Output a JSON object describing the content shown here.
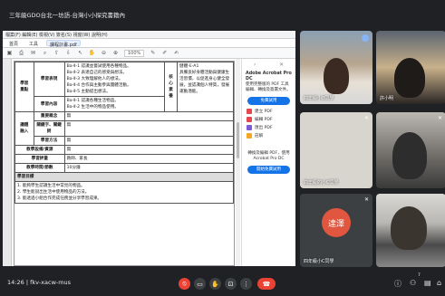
{
  "meeting": {
    "title": "三年級GDO台北一坊語-台灣小小探究書籍內",
    "time": "14:26",
    "code": "fkv-xacw-mus",
    "participants_badge": "7"
  },
  "document": {
    "menubar": "檔案(F)  編輯(E)  檢視(V)  簽名(S)  視窗(W)  說明(H)",
    "tabs": [
      "首頁",
      "工具",
      "課程計畫.pdf"
    ],
    "zoom": "100%",
    "rows": [
      {
        "label": "學習表現",
        "text": "Ba-Ⅱ-1 認識並嘗試使用各種物品。\nBa-Ⅱ-2 表達自己的感受與想法。\nBa-Ⅱ-3 大致理解他人的想法。\nBa-Ⅱ-4 合作與主動參與團體活動。\nBa-Ⅱ-5 主動提出想法。",
        "right_label": "核心素養",
        "right_text": "健體-E-A1\n具備良好身體活動與健康生活習慣，以促進身心健全發展，並認識個人特質，發展運動潛能。"
      },
      {
        "label": "學習內容",
        "text": "Ba-Ⅱ-1 認識各種生活物品。\nBa-Ⅱ-2 生活中的物品使用。"
      },
      {
        "label": "重要概念",
        "text": "無"
      },
      {
        "label": "關鍵字、關鍵詞",
        "text": "無"
      },
      {
        "label": "學習方法",
        "text": "無"
      },
      {
        "label": "教學設備/資源",
        "text": "無"
      },
      {
        "label": "學習評量",
        "text": "教師、家長"
      },
      {
        "label": "教學時間/節數",
        "text": "10分鐘"
      }
    ],
    "goals_header": "學習目標",
    "goals": [
      "1. 能夠學生認識生活中常見的物品。",
      "2. 學生能說出生活中使用物品的方法。",
      "3. 能透過小組合作完成任務並分享學習成果。"
    ]
  },
  "acrobat_panel": {
    "promo_head": "Adobe Acrobat Pro DC",
    "promo_body": "使用完整版的 PDF 工具編輯、轉換及簽署文件。",
    "try_button": "免費試用",
    "items": [
      {
        "label": "建立 PDF",
        "color": "#e34850",
        "icon": "create-pdf-icon"
      },
      {
        "label": "編輯 PDF",
        "color": "#e34850",
        "icon": "edit-pdf-icon"
      },
      {
        "label": "匯出 PDF",
        "color": "#7b5bdc",
        "icon": "export-pdf-icon"
      },
      {
        "label": "註解",
        "color": "#f5a623",
        "icon": "comment-icon"
      }
    ],
    "promo2": "轉換及編輯 PDF，使用 Acrobat Pro DC",
    "free_button": "開始免費試用"
  },
  "participants": [
    {
      "name": "四年級小B同學",
      "tile": "t1"
    },
    {
      "name": "許小明",
      "tile": "t2"
    },
    {
      "name": "四年級的小C同學",
      "tile": "t3"
    },
    {
      "name": "",
      "tile": "t4"
    },
    {
      "name": "四年級小C同學",
      "tile": "t5",
      "avatar": "達澤",
      "avatar_color": "#e1563e"
    },
    {
      "name": "",
      "tile": "t6"
    }
  ],
  "controls": {
    "mic": "mic-off-icon",
    "camera": "camera-icon",
    "raise_hand": "raise-hand-icon",
    "present": "present-icon",
    "more": "more-options-icon",
    "leave": "leave-call-icon"
  }
}
